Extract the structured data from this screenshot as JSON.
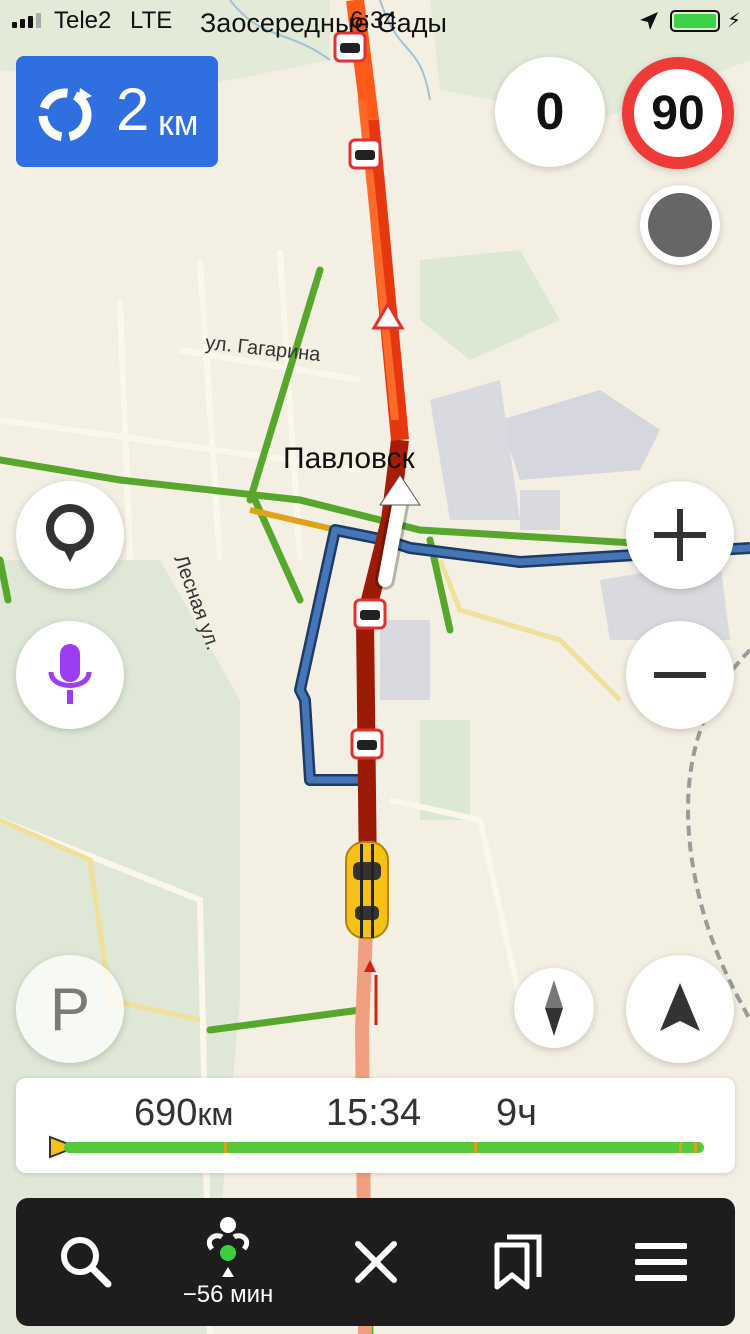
{
  "status_bar": {
    "carrier": "Tele2",
    "network": "LTE",
    "street": "Заосередные Сады",
    "time": "6:34"
  },
  "maneuver": {
    "distance": "2",
    "unit": "км",
    "icon": "roundabout-icon"
  },
  "speed": {
    "current": "0",
    "limit": "90"
  },
  "map": {
    "city_label": "Павловск",
    "street_gagarina": "ул. Гагарина",
    "street_lesnaya": "Лесная ул."
  },
  "route_panel": {
    "distance": "690",
    "distance_unit": "км",
    "arrival_time": "15:34",
    "duration": "9ч"
  },
  "bottom_bar": {
    "alt_routes_label": "−56 мин",
    "items": [
      "search-icon",
      "alt-routes-icon",
      "close-icon",
      "bookmark-icon",
      "menu-icon"
    ]
  },
  "colors": {
    "accent_blue": "#2f6fe0",
    "traffic_red": "#c62a0e",
    "traffic_orange": "#ff5a18",
    "traffic_green": "#58a72d",
    "alt_route": "#2f5b9a",
    "limit_ring": "#ef3b38",
    "mic_purple": "#9b3df0"
  }
}
